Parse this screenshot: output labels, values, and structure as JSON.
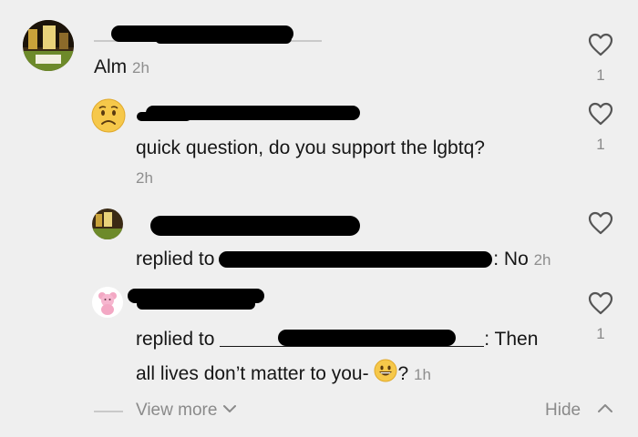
{
  "comments": [
    {
      "username": "Alm",
      "time": "2h",
      "likes": "1"
    },
    {
      "text": "quick question, do you support the lgbtq?",
      "time": "2h",
      "likes": "1"
    },
    {
      "prefix": "replied to",
      "text": ": No",
      "time": "2h"
    },
    {
      "prefix": "replied to",
      "text_line1": ": Then",
      "text_line2": "all lives don’t matter to you-",
      "text_tail": "?",
      "time": "1h",
      "likes": "1"
    }
  ],
  "footer": {
    "view_more": "View more",
    "hide": "Hide"
  },
  "colors": {
    "heart": "#555555",
    "muted": "#8e8e8e",
    "background": "#efefef"
  },
  "icons": [
    "heart-icon",
    "chevron-down-icon",
    "chevron-up-icon",
    "grinning-face-emoji",
    "worried-face-emoji"
  ]
}
